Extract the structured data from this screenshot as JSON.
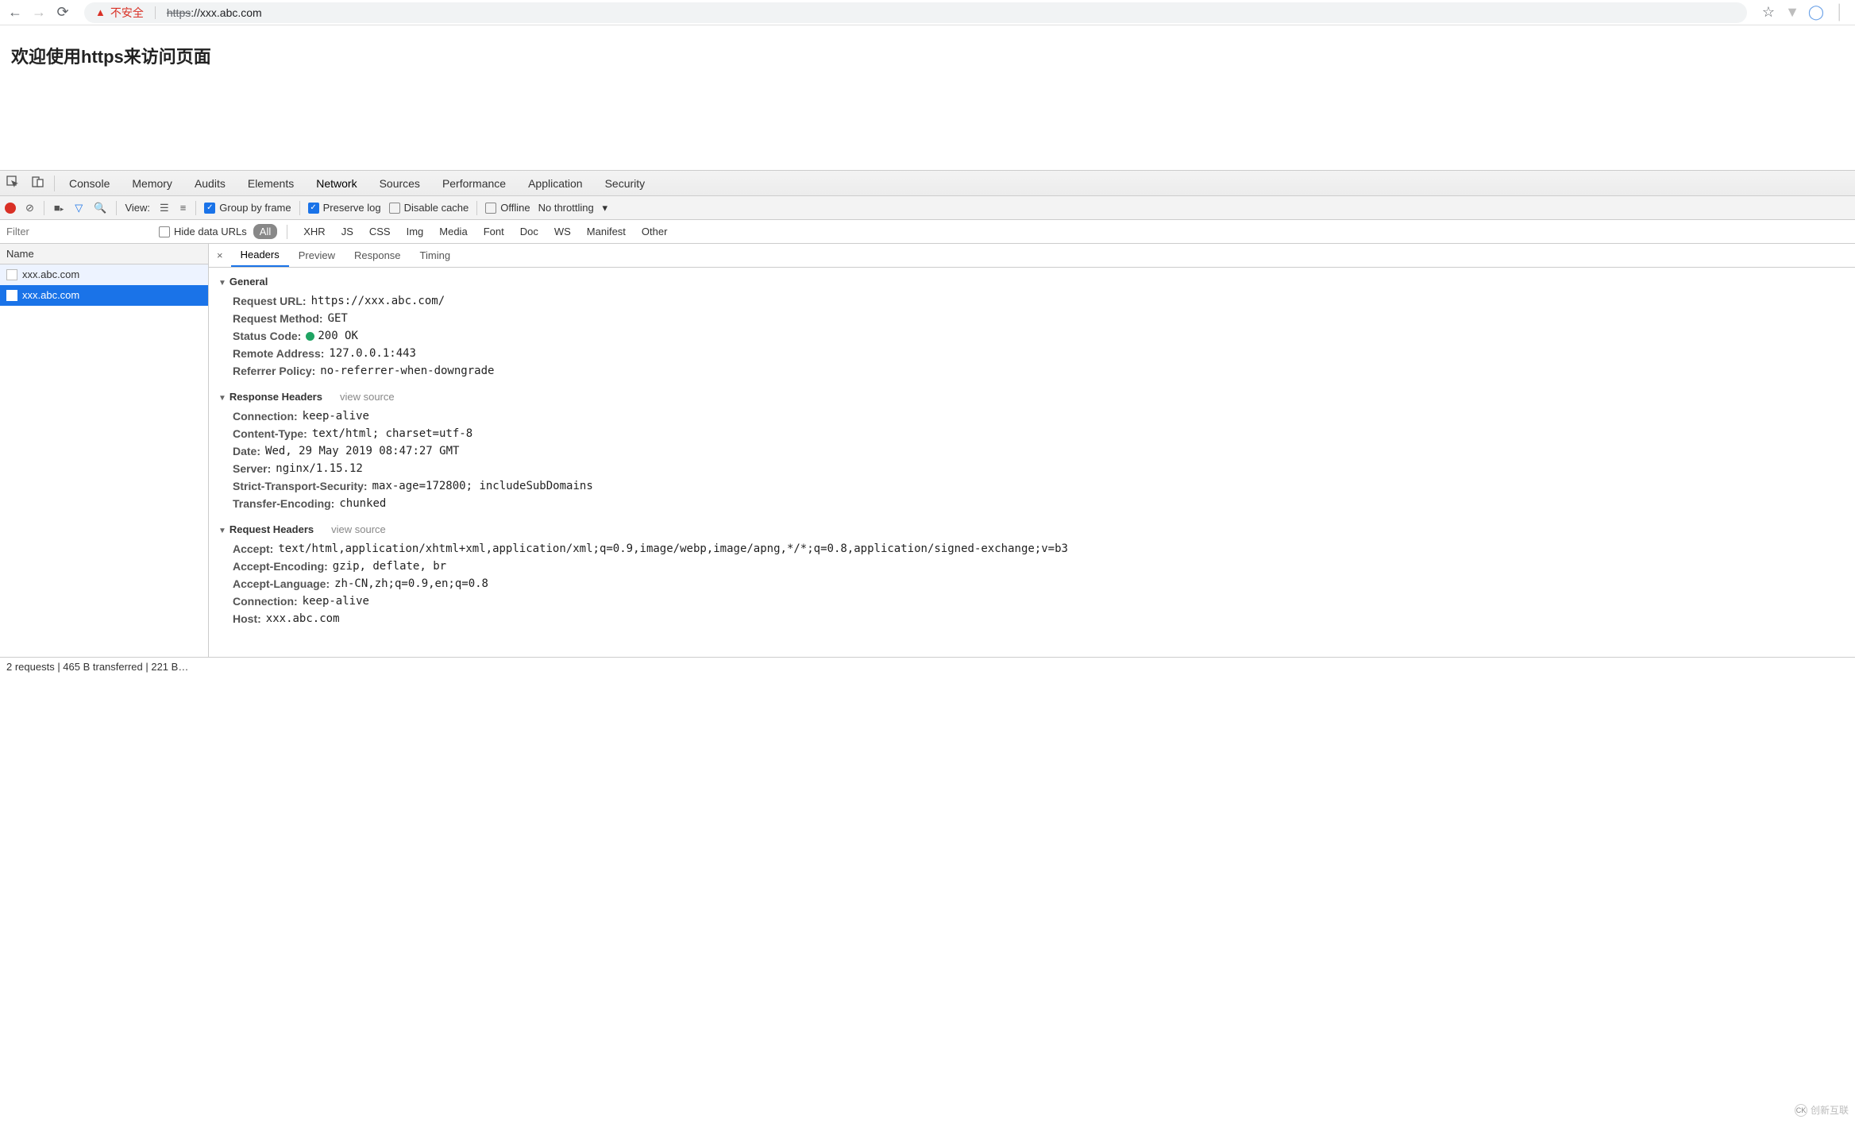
{
  "browser": {
    "security_label": "不安全",
    "url_strike": "https",
    "url_rest": "://xxx.abc.com"
  },
  "page": {
    "heading": "欢迎使用https来访问页面"
  },
  "devtools": {
    "tabs": [
      "Console",
      "Memory",
      "Audits",
      "Elements",
      "Network",
      "Sources",
      "Performance",
      "Application",
      "Security"
    ],
    "active_tab": "Network",
    "toolbar": {
      "view_label": "View:",
      "group_by_frame": "Group by frame",
      "preserve_log": "Preserve log",
      "disable_cache": "Disable cache",
      "offline": "Offline",
      "throttling": "No throttling"
    },
    "filter": {
      "placeholder": "Filter",
      "hide_data_urls": "Hide data URLs",
      "types": [
        "All",
        "XHR",
        "JS",
        "CSS",
        "Img",
        "Media",
        "Font",
        "Doc",
        "WS",
        "Manifest",
        "Other"
      ],
      "active_type": "All"
    },
    "reqlist": {
      "header": "Name",
      "rows": [
        "xxx.abc.com",
        "xxx.abc.com"
      ],
      "selected_index": 1
    },
    "detail_tabs": [
      "Headers",
      "Preview",
      "Response",
      "Timing"
    ],
    "active_detail_tab": "Headers",
    "sections": {
      "general": {
        "title": "General",
        "items": [
          {
            "k": "Request URL:",
            "v": "https://xxx.abc.com/"
          },
          {
            "k": "Request Method:",
            "v": "GET"
          },
          {
            "k": "Status Code:",
            "v": "200 OK",
            "status": true
          },
          {
            "k": "Remote Address:",
            "v": "127.0.0.1:443"
          },
          {
            "k": "Referrer Policy:",
            "v": "no-referrer-when-downgrade"
          }
        ]
      },
      "response": {
        "title": "Response Headers",
        "view_source": "view source",
        "items": [
          {
            "k": "Connection:",
            "v": "keep-alive"
          },
          {
            "k": "Content-Type:",
            "v": "text/html; charset=utf-8"
          },
          {
            "k": "Date:",
            "v": "Wed, 29 May 2019 08:47:27 GMT"
          },
          {
            "k": "Server:",
            "v": "nginx/1.15.12"
          },
          {
            "k": "Strict-Transport-Security:",
            "v": "max-age=172800; includeSubDomains"
          },
          {
            "k": "Transfer-Encoding:",
            "v": "chunked"
          }
        ]
      },
      "request": {
        "title": "Request Headers",
        "view_source": "view source",
        "items": [
          {
            "k": "Accept:",
            "v": "text/html,application/xhtml+xml,application/xml;q=0.9,image/webp,image/apng,*/*;q=0.8,application/signed-exchange;v=b3"
          },
          {
            "k": "Accept-Encoding:",
            "v": "gzip, deflate, br"
          },
          {
            "k": "Accept-Language:",
            "v": "zh-CN,zh;q=0.9,en;q=0.8"
          },
          {
            "k": "Connection:",
            "v": "keep-alive"
          },
          {
            "k": "Host:",
            "v": "xxx.abc.com"
          }
        ]
      }
    }
  },
  "footer": "2 requests | 465 B transferred | 221 B…",
  "watermark": "创新互联"
}
